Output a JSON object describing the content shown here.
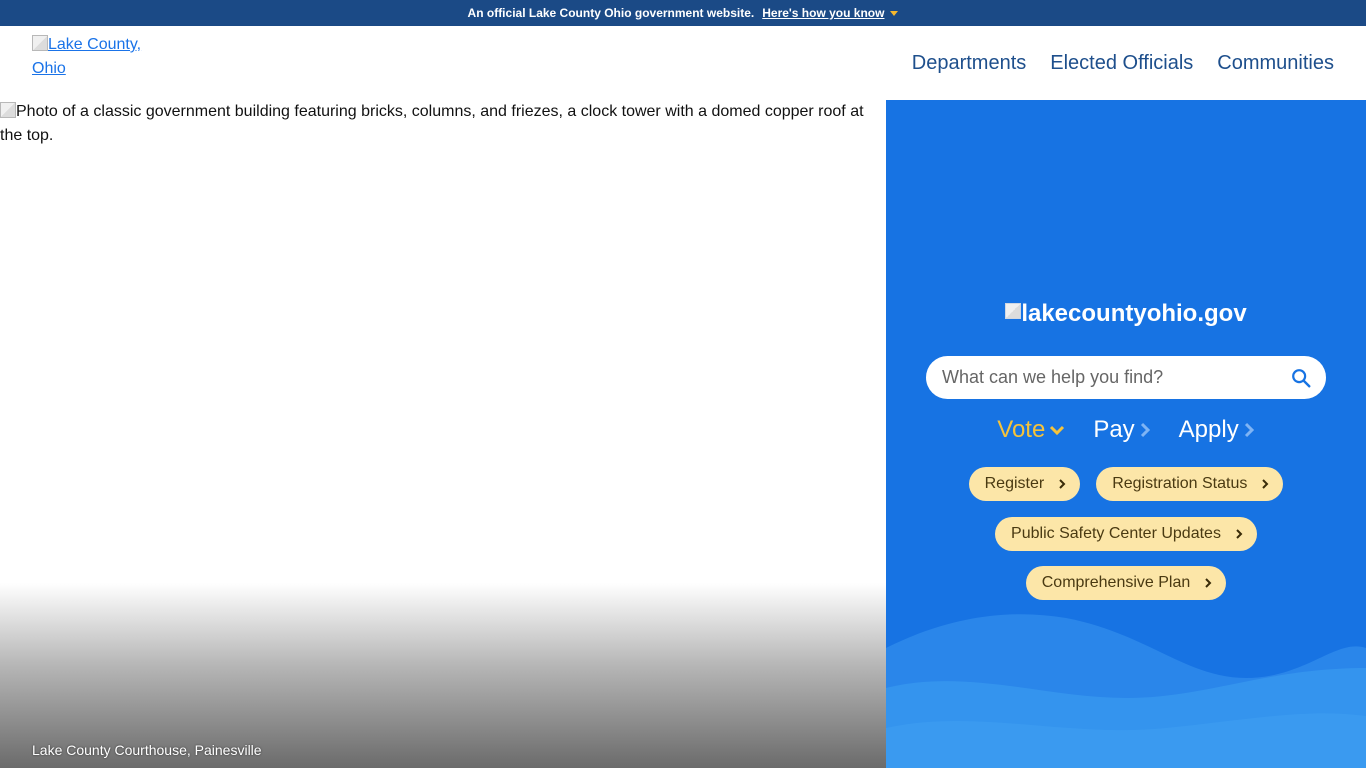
{
  "banner": {
    "text": "An official Lake County Ohio government website.",
    "link": "Here's how you know"
  },
  "header": {
    "logo_alt": "Lake County, Ohio",
    "nav": [
      "Departments",
      "Elected Officials",
      "Communities"
    ]
  },
  "hero": {
    "image_alt": "Photo of a classic government building featuring bricks, columns, and friezes, a clock tower with a domed copper roof at the top.",
    "caption": "Lake County Courthouse, Painesville"
  },
  "panel": {
    "logo_alt": "lakecountyohio.gov",
    "search": {
      "placeholder": "What can we help you find?",
      "value": ""
    },
    "tabs": [
      {
        "label": "Vote",
        "active": true
      },
      {
        "label": "Pay",
        "active": false
      },
      {
        "label": "Apply",
        "active": false
      }
    ],
    "links": [
      [
        "Register",
        "Registration Status"
      ],
      [
        "Public Safety Center Updates"
      ],
      [
        "Comprehensive Plan"
      ]
    ]
  },
  "colors": {
    "banner_bg": "#1b4a86",
    "nav_text": "#1e4f8c",
    "panel_bg": "#1773e3",
    "active_tab": "#f5c33b",
    "chip_bg": "#fce6a8"
  }
}
